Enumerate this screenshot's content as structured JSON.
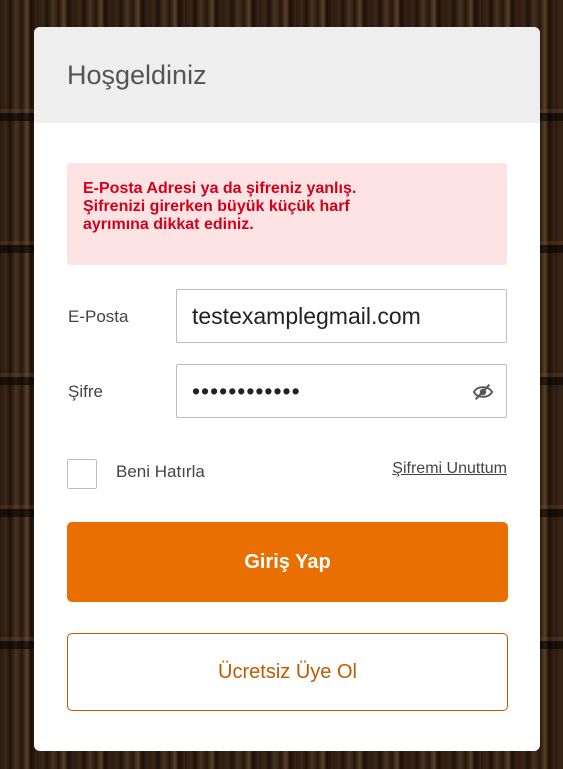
{
  "header": {
    "title": "Hoşgeldiniz"
  },
  "alert": {
    "line1": "E-Posta Adresi ya da şifreniz yanlış.",
    "line2": "Şifrenizi girerken büyük küçük harf",
    "line3": "ayrımına dikkat ediniz."
  },
  "form": {
    "email_label": "E-Posta",
    "email_value": "testexamplegmail.com",
    "password_label": "Şifre",
    "password_value": "••••••••••••",
    "password_toggle_icon": "eye-slash-icon",
    "remember_label": "Beni Hatırla",
    "remember_checked": false,
    "forgot_link": "Şifremi Unuttum"
  },
  "buttons": {
    "login_label": "Giriş Yap",
    "signup_label": "Ücretsiz Üye Ol"
  },
  "colors": {
    "accent": "#e86f00",
    "alert_bg": "#fde3e3",
    "alert_text": "#d0021b"
  }
}
